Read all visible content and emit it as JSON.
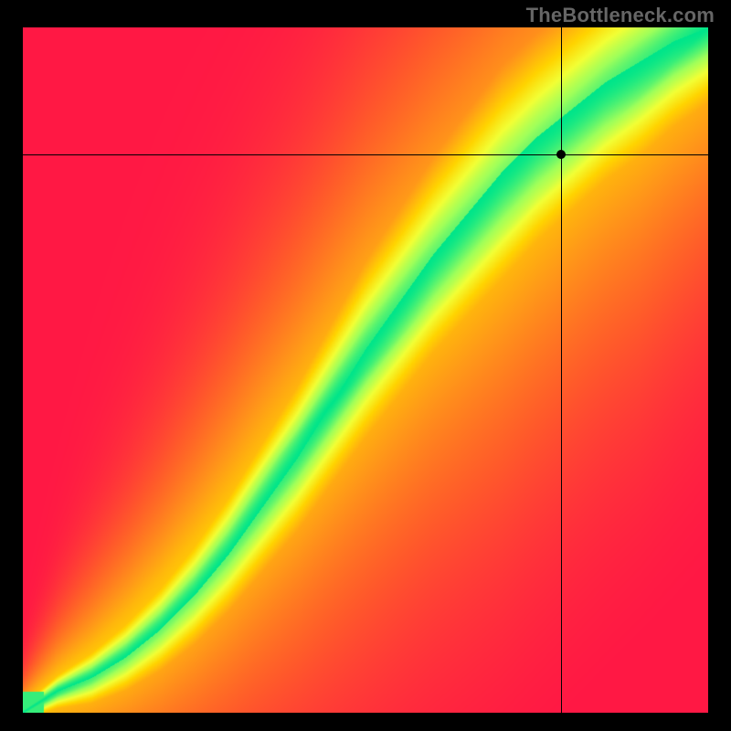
{
  "watermark": "TheBottleneck.com",
  "chart_data": {
    "type": "heatmap",
    "title": "",
    "xlabel": "",
    "ylabel": "",
    "xlim": [
      0,
      1
    ],
    "ylim": [
      0,
      1
    ],
    "colormap": {
      "stops": [
        {
          "t": 0.0,
          "color": "#ff1844"
        },
        {
          "t": 0.2,
          "color": "#ff5a2a"
        },
        {
          "t": 0.4,
          "color": "#ff9a18"
        },
        {
          "t": 0.58,
          "color": "#ffd400"
        },
        {
          "t": 0.72,
          "color": "#f2ff35"
        },
        {
          "t": 0.85,
          "color": "#9fff5a"
        },
        {
          "t": 1.0,
          "color": "#00e58a"
        }
      ]
    },
    "ridge": {
      "description": "Monotone ridge y = f(x) along which the heatmap peaks (green band)",
      "x": [
        0.0,
        0.05,
        0.1,
        0.15,
        0.2,
        0.25,
        0.3,
        0.35,
        0.4,
        0.45,
        0.5,
        0.55,
        0.6,
        0.65,
        0.7,
        0.75,
        0.8,
        0.85,
        0.9,
        0.95,
        1.0
      ],
      "y": [
        0.0,
        0.03,
        0.05,
        0.08,
        0.12,
        0.17,
        0.23,
        0.3,
        0.37,
        0.45,
        0.53,
        0.6,
        0.67,
        0.73,
        0.79,
        0.84,
        0.88,
        0.92,
        0.95,
        0.98,
        1.0
      ]
    },
    "band_halfwidth": {
      "description": "Approx half-width of the bright band along y at each x",
      "x": [
        0.0,
        0.1,
        0.3,
        0.5,
        0.7,
        0.9,
        1.0
      ],
      "h": [
        0.006,
        0.02,
        0.045,
        0.07,
        0.085,
        0.075,
        0.06
      ]
    },
    "crosshair": {
      "x": 0.785,
      "y": 0.815
    },
    "marker": {
      "x": 0.785,
      "y": 0.815
    }
  }
}
